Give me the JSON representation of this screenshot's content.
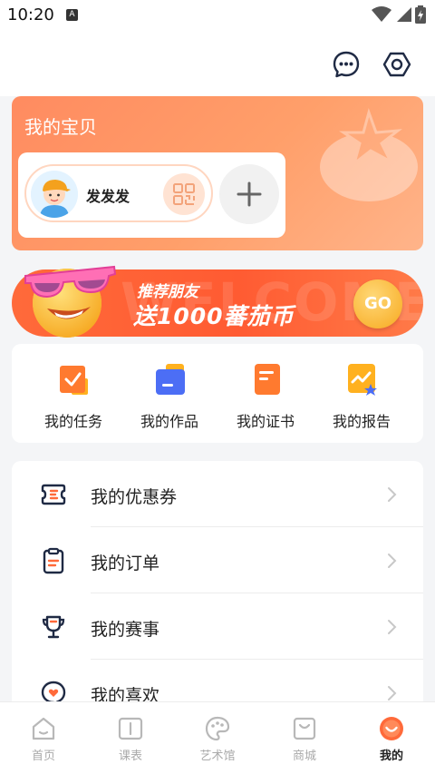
{
  "status_bar": {
    "time": "10:20",
    "notification_badge": "A"
  },
  "header": {
    "icons": [
      "message-icon",
      "settings-icon"
    ]
  },
  "baby_card": {
    "title": "我的宝贝",
    "baby_name": "发发发",
    "icons": [
      "qr-code-icon",
      "add-icon"
    ]
  },
  "banner": {
    "line1": "推荐朋友",
    "line2": "送1000蕃茄币",
    "button": "GO",
    "bg_text": "WELCOME"
  },
  "quick_actions": [
    {
      "label": "我的任务",
      "icon": "task-icon"
    },
    {
      "label": "我的作品",
      "icon": "works-icon"
    },
    {
      "label": "我的证书",
      "icon": "certificate-icon"
    },
    {
      "label": "我的报告",
      "icon": "report-icon"
    }
  ],
  "menu": [
    {
      "label": "我的优惠券",
      "icon": "coupon-icon"
    },
    {
      "label": "我的订单",
      "icon": "order-icon"
    },
    {
      "label": "我的赛事",
      "icon": "trophy-icon"
    },
    {
      "label": "我的喜欢",
      "icon": "heart-icon"
    }
  ],
  "tabbar": [
    {
      "label": "首页",
      "icon": "home-icon",
      "active": false
    },
    {
      "label": "课表",
      "icon": "schedule-icon",
      "active": false
    },
    {
      "label": "艺术馆",
      "icon": "palette-icon",
      "active": false
    },
    {
      "label": "商城",
      "icon": "shop-icon",
      "active": false
    },
    {
      "label": "我的",
      "icon": "profile-icon",
      "active": true
    }
  ],
  "colors": {
    "accent": "#ff6a3a",
    "card_gradient_start": "#ff8b60",
    "active_tab": "#ff6a3a",
    "icon_navy": "#1f2a44"
  }
}
